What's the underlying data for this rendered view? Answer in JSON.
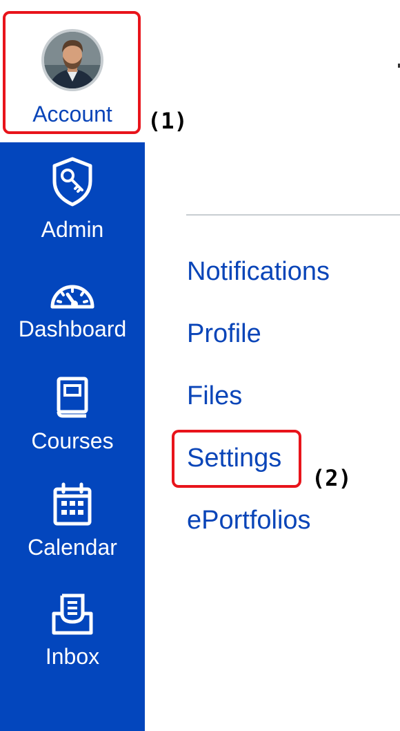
{
  "global_nav": {
    "account": {
      "label": "Account",
      "icon": "avatar"
    },
    "items": [
      {
        "label": "Admin",
        "icon": "shield-key-icon"
      },
      {
        "label": "Dashboard",
        "icon": "speedometer-icon"
      },
      {
        "label": "Courses",
        "icon": "book-icon"
      },
      {
        "label": "Calendar",
        "icon": "calendar-icon"
      },
      {
        "label": "Inbox",
        "icon": "inbox-icon"
      }
    ]
  },
  "account_menu": {
    "links": [
      "Notifications",
      "Profile",
      "Files",
      "Settings",
      "ePortfolios"
    ]
  },
  "callouts": [
    "(1)",
    "(2)"
  ],
  "colors": {
    "nav_bg": "#0346bd",
    "link": "#0a45b8",
    "callout": "#e8141b"
  }
}
